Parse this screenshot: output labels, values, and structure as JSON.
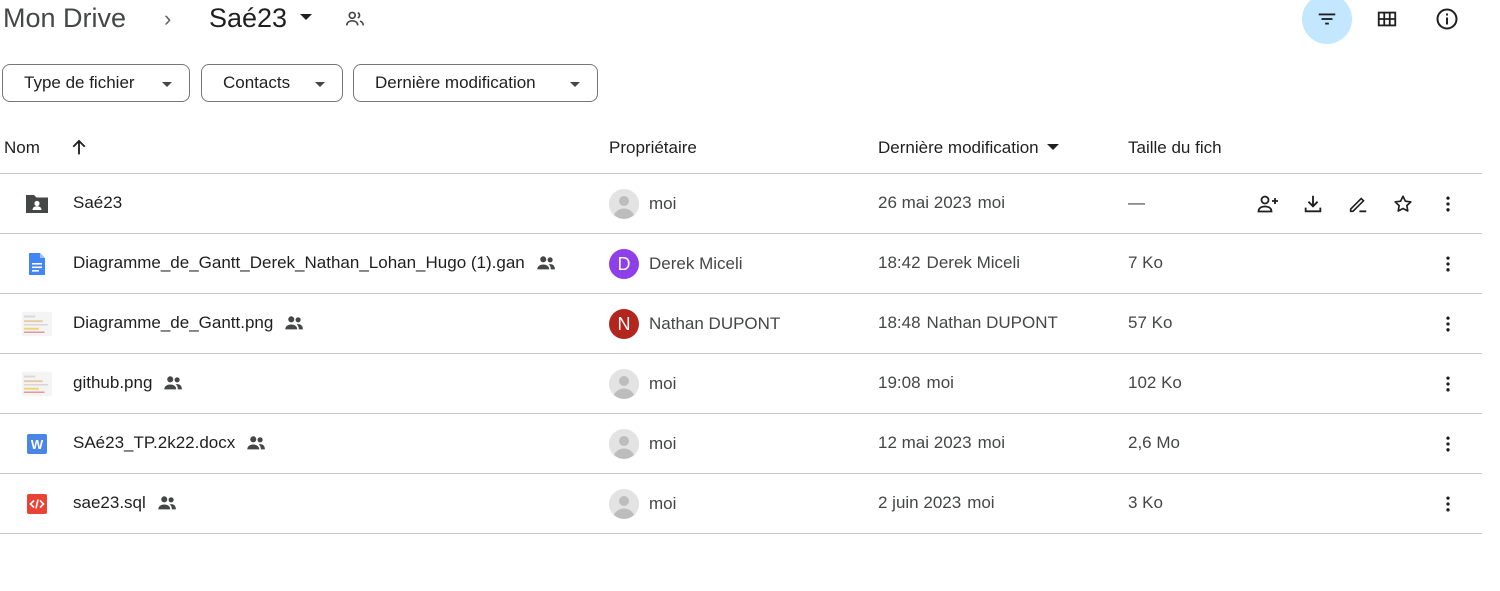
{
  "breadcrumb": {
    "root": "Mon Drive",
    "separator": "›",
    "current": "Saé23"
  },
  "toolbar": {
    "filter_icon": "filter-icon",
    "grid_icon": "grid-view-icon",
    "info_icon": "info-icon",
    "active_color": "#c2e7ff"
  },
  "filters": [
    {
      "label": "Type de fichier"
    },
    {
      "label": "Contacts"
    },
    {
      "label": "Dernière modification"
    }
  ],
  "table": {
    "columns": {
      "name": "Nom",
      "owner": "Propriétaire",
      "modified": "Dernière modification",
      "size": "Taille du fich"
    },
    "rows": [
      {
        "name": "Saé23",
        "icon": "shared-folder-icon",
        "shared": false,
        "owner": "moi",
        "avatar": "",
        "avatar_color": "",
        "modified_date": "26 mai 2023",
        "modified_by": "moi",
        "size": "—"
      },
      {
        "name": "Diagramme_de_Gantt_Derek_Nathan_Lohan_Hugo (1).gan",
        "icon": "document-icon",
        "shared": true,
        "owner": "Derek Miceli",
        "avatar": "D",
        "avatar_color": "#8e3fe8",
        "modified_date": "18:42",
        "modified_by": "Derek Miceli",
        "size": "7 Ko"
      },
      {
        "name": "Diagramme_de_Gantt.png",
        "icon": "image-thumbnail-icon",
        "shared": true,
        "owner": "Nathan DUPONT",
        "avatar": "N",
        "avatar_color": "#b3261e",
        "modified_date": "18:48",
        "modified_by": "Nathan DUPONT",
        "size": "57 Ko"
      },
      {
        "name": "github.png",
        "icon": "image-thumbnail-icon",
        "shared": true,
        "owner": "moi",
        "avatar": "",
        "avatar_color": "",
        "modified_date": "19:08",
        "modified_by": "moi",
        "size": "102 Ko"
      },
      {
        "name": "SAé23_TP.2k22.docx",
        "icon": "word-icon",
        "shared": true,
        "owner": "moi",
        "avatar": "",
        "avatar_color": "",
        "modified_date": "12 mai 2023",
        "modified_by": "moi",
        "size": "2,6 Mo"
      },
      {
        "name": "sae23.sql",
        "icon": "code-file-icon",
        "shared": true,
        "owner": "moi",
        "avatar": "",
        "avatar_color": "",
        "modified_date": "2 juin 2023",
        "modified_by": "moi",
        "size": "3 Ko"
      }
    ]
  },
  "row_actions": [
    "share-icon",
    "download-icon",
    "rename-icon",
    "star-icon"
  ]
}
